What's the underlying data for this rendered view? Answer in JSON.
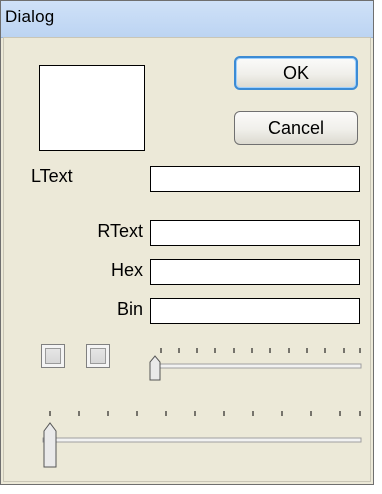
{
  "window": {
    "title": "Dialog"
  },
  "buttons": {
    "ok_label": "OK",
    "cancel_label": "Cancel"
  },
  "fields": {
    "ltext": {
      "label": "LText",
      "value": ""
    },
    "rtext": {
      "label": "RText",
      "value": ""
    },
    "hex": {
      "label": "Hex",
      "value": ""
    },
    "bin": {
      "label": "Bin",
      "value": ""
    }
  },
  "checkboxes": [
    {
      "checked": false
    },
    {
      "checked": false
    }
  ],
  "sliders": [
    {
      "position": 0
    },
    {
      "position": 0
    }
  ]
}
